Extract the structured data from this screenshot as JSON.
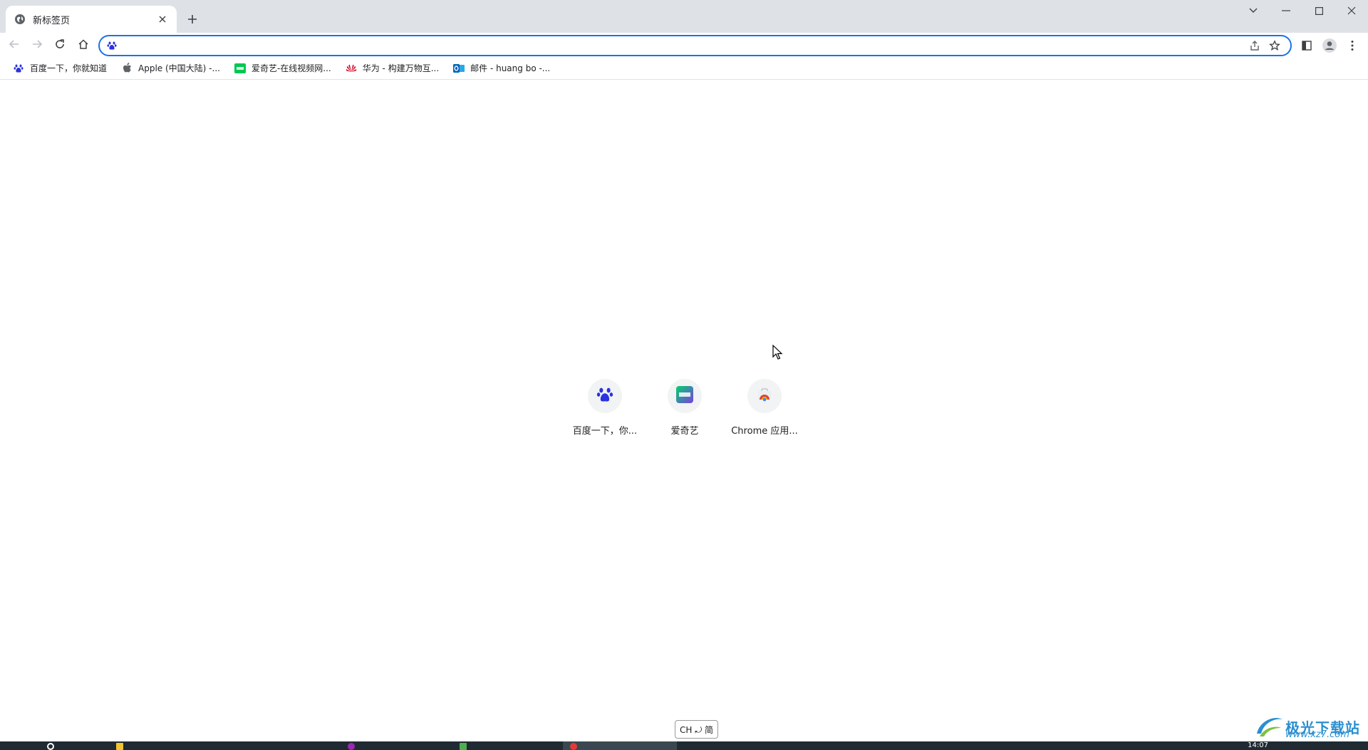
{
  "tab": {
    "title": "新标签页"
  },
  "omnibox": {
    "value": "",
    "placeholder": ""
  },
  "bookmarks": [
    {
      "label": "百度一下，你就知道",
      "icon": "baidu-icon"
    },
    {
      "label": "Apple (中国大陆) -...",
      "icon": "apple-icon"
    },
    {
      "label": "爱奇艺-在线视频网...",
      "icon": "iqiyi-icon"
    },
    {
      "label": "华为 - 构建万物互...",
      "icon": "huawei-icon"
    },
    {
      "label": "邮件 - huang bo -...",
      "icon": "outlook-icon"
    }
  ],
  "shortcuts": [
    {
      "label": "百度一下，你...",
      "icon": "baidu-icon"
    },
    {
      "label": "爱奇艺",
      "icon": "iqiyi-icon"
    },
    {
      "label": "Chrome 应用...",
      "icon": "chrome-webstore-icon"
    }
  ],
  "ime": {
    "label": "CH ⤾ 简"
  },
  "watermark": {
    "text": "极光下载站",
    "sub": "www.xz7.com"
  },
  "taskbar": {
    "time": "14:07"
  },
  "colors": {
    "accent": "#1a73e8",
    "tabstrip": "#dee1e6",
    "taskbar": "#1f2a33"
  }
}
